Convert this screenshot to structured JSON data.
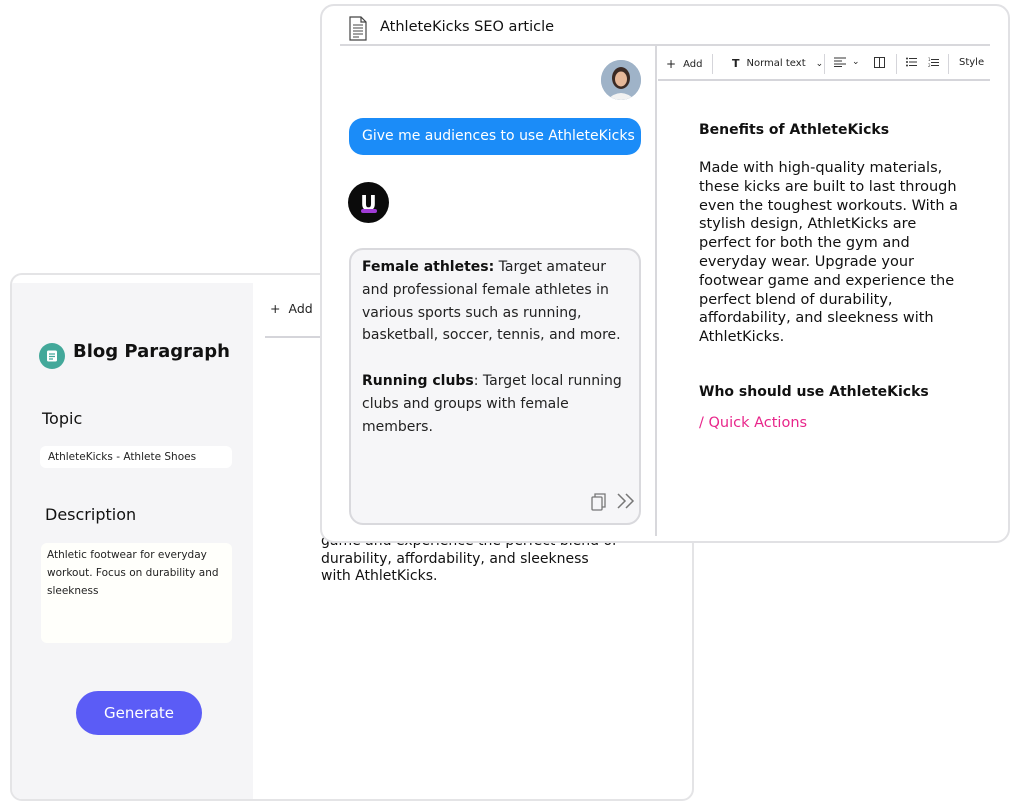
{
  "blog_app": {
    "title": "Blog Paragraph",
    "topic_label": "Topic",
    "topic_value": "AthleteKicks - Athlete Shoes",
    "description_label": "Description",
    "description_value": "Athletic footwear for everyday workout. Focus on durability and sleekness",
    "generate_label": "Generate",
    "add_label": "Add",
    "partial_text": "game and experience the perfect blend of durability, affordability, and sleekness with AthletKicks."
  },
  "article_window": {
    "title": "AthleteKicks SEO article",
    "chat": {
      "user_message": "Give me audiences to use AthleteKicks",
      "bot_logo_letter": "U",
      "response": [
        {
          "bold": "Female athletes:",
          "text": " Target amateur and professional female athletes in various sports such as running, basketball, soccer, tennis, and more."
        },
        {
          "bold": "Running clubs",
          "text": ": Target local running clubs and groups with female members."
        }
      ]
    },
    "toolbar": {
      "add": "Add",
      "text_style": "Normal text",
      "style": "Style"
    },
    "editor": {
      "heading1": "Benefits of AthleteKicks",
      "paragraph": "Made with high-quality materials, these kicks are built to last through even the toughest workouts. With a stylish design, AthletKicks are perfect for both the gym and everyday wear. Upgrade your footwear game and experience the perfect blend of durability, affordability, and sleekness with AthletKicks.",
      "heading2": "Who should use AthleteKicks",
      "quick_actions": "/ Quick Actions"
    }
  },
  "colors": {
    "primary_button": "#5b5cf6",
    "user_bubble": "#1b8cf8",
    "quick_actions": "#e8258a"
  }
}
